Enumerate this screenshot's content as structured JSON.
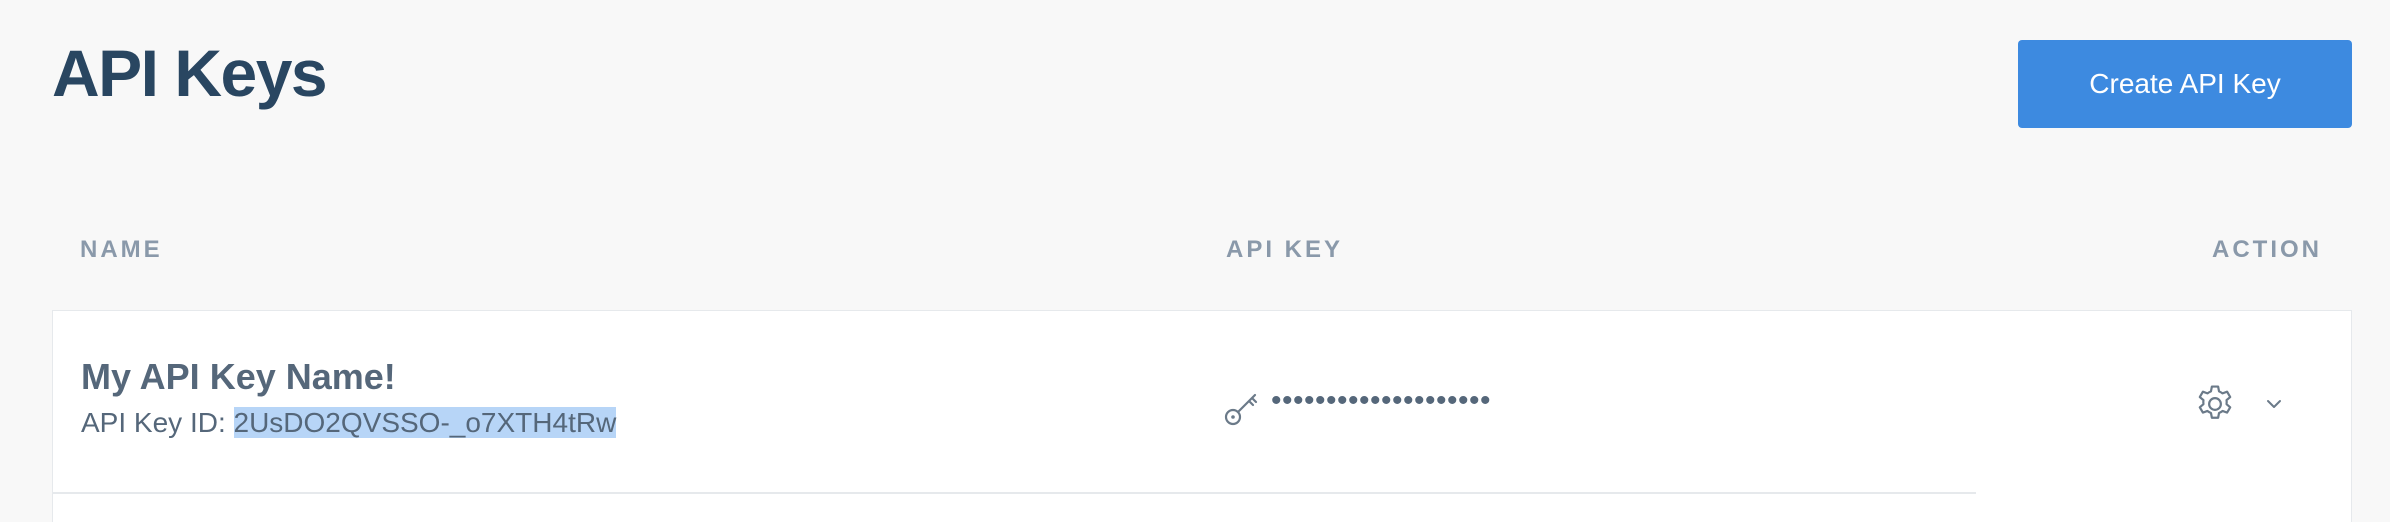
{
  "header": {
    "title": "API Keys",
    "create_button_label": "Create API Key"
  },
  "table": {
    "columns": [
      "NAME",
      "API KEY",
      "ACTION"
    ],
    "rows": [
      {
        "name": "My API Key Name!",
        "id_label": "API Key ID: ",
        "id_value": "2UsDO2QVSSO-_o7XTH4tRw",
        "masked_key": "••••••••••••••••••••",
        "key_icon": "key-icon",
        "action_icons": [
          "gear-icon",
          "chevron-down-icon"
        ]
      }
    ]
  },
  "colors": {
    "title": "#294661",
    "primary_button": "#3d8ae0",
    "header_text": "#8a99aa",
    "selection_highlight": "#b7d5f7"
  }
}
